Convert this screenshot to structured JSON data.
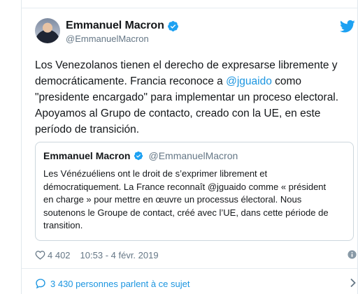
{
  "author": {
    "name": "Emmanuel Macron",
    "handle": "@EmmanuelMacron"
  },
  "tweet": {
    "text_part1": "Los Venezolanos tienen el derecho de expresarse libremente y democráticamente. Francia reconoce a ",
    "mention": "@jguaido",
    "text_part2": " como \"presidente encargado\" para implementar un proceso electoral. Apoyamos al Grupo de contacto, creado con la UE, en este período de transición."
  },
  "quoted_tweet": {
    "name": "Emmanuel Macron",
    "handle": "@EmmanuelMacron",
    "text": "Les Vénézuéliens ont le droit de s’exprimer librement et démocratiquement. La France reconnaît @jguaido comme « président en charge » pour mettre en œuvre un processus électoral. Nous soutenons le Groupe de contact, créé avec l’UE, dans cette période de transition."
  },
  "meta": {
    "likes": "4 402",
    "timestamp": "10:53 - 4 févr. 2019"
  },
  "conversation": {
    "label": "3 430 personnes parlent à ce sujet"
  },
  "colors": {
    "link": "#1b95e0",
    "secondary_text": "#657786",
    "border": "#e6ecf0",
    "verified": "#1da1f2"
  },
  "icons": [
    "verified-badge-icon",
    "twitter-bird-icon",
    "heart-icon",
    "info-icon",
    "speech-bubble-icon",
    "chevron-right-icon"
  ]
}
